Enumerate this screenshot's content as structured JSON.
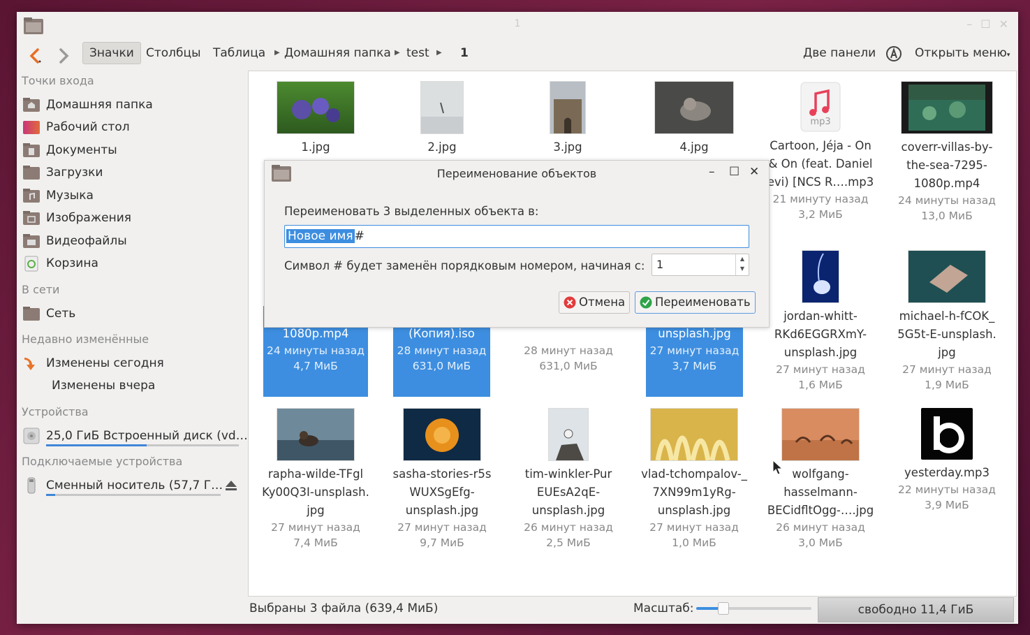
{
  "window": {
    "title": "1"
  },
  "toolbar": {
    "views": [
      "Значки",
      "Столбцы",
      "Таблица"
    ],
    "breadcrumb": [
      "Домашняя папка",
      "test",
      "1"
    ],
    "dual_pane": "Две панели",
    "open_menu": "Открыть меню"
  },
  "sidebar": {
    "headings": [
      "Точки входа",
      "В сети",
      "Недавно изменённые",
      "Устройства",
      "Подключаемые устройства"
    ],
    "places": [
      "Домашняя папка",
      "Рабочий стол",
      "Документы",
      "Загрузки",
      "Музыка",
      "Изображения",
      "Видеофайлы",
      "Корзина"
    ],
    "network": [
      "Сеть"
    ],
    "recent": [
      "Изменены сегодня",
      "Изменены вчера"
    ],
    "devices": [
      {
        "label": "25,0 ГиБ Встроенный диск (vd…",
        "usage": 0.52
      }
    ],
    "removable": [
      {
        "label": "Сменный носитель (57,7 Г…",
        "usage": 0.05
      }
    ]
  },
  "files": [
    {
      "name": "1.jpg"
    },
    {
      "name": "2.jpg"
    },
    {
      "name": "3.jpg"
    },
    {
      "name": "4.jpg"
    },
    {
      "name": "Cartoon, Jéja - On\n& On (feat. Daniel\nevi) [NCS R….mp3",
      "time": "21 минуту назад",
      "size": "3,2 МиБ"
    },
    {
      "name": "coverr-villas-by-\nthe-sea-7295-\n1080p.mp4",
      "time": "24 минуты назад",
      "size": "13,0 МиБ"
    },
    {
      "name": "1080p.mp4",
      "time": "24 минуты назад",
      "size": "4,7 МиБ"
    },
    {
      "name": "(Копия).iso",
      "time": "28 минут назад",
      "size": "631,0 МиБ"
    },
    {
      "name": "",
      "time": "28 минут назад",
      "size": "631,0 МиБ"
    },
    {
      "name": "unsplash.jpg",
      "time": "27 минут назад",
      "size": "3,7 МиБ"
    },
    {
      "name": "jordan-whitt-\nRKd6EGGRXmY-\nunsplash.jpg",
      "time": "27 минут назад",
      "size": "1,6 МиБ"
    },
    {
      "name": "michael-h-fCOK_\n5G5t-E-unsplash.\njpg",
      "time": "27 минут назад",
      "size": "1,9 МиБ"
    },
    {
      "name": "rapha-wilde-TFgl\nKy00Q3I-unsplash.\njpg",
      "time": "27 минут назад",
      "size": "7,4 МиБ"
    },
    {
      "name": "sasha-stories-r5s\nWUXSgEfg-\nunsplash.jpg",
      "time": "27 минут назад",
      "size": "9,7 МиБ"
    },
    {
      "name": "tim-winkler-Pur\nEUEsA2qE-\nunsplash.jpg",
      "time": "26 минут назад",
      "size": "2,5 МиБ"
    },
    {
      "name": "vlad-tchompalov-_\n7XN99m1yRg-\nunsplash.jpg",
      "time": "27 минут назад",
      "size": "1,0 МиБ"
    },
    {
      "name": "wolfgang-\nhasselmann-\nBECidfltOgg-….jpg",
      "time": "26 минут назад",
      "size": "3,0 МиБ"
    },
    {
      "name": "yesterday.mp3",
      "time": "22 минуты назад",
      "size": "3,9 МиБ"
    }
  ],
  "dialog": {
    "title": "Переименование объектов",
    "prompt": "Переименовать 3 выделенных объекта в:",
    "name_selected": "Новое имя",
    "name_rest": "#",
    "hint": "Символ # будет заменён порядковым номером, начиная с:",
    "start_value": "1",
    "cancel": "Отмена",
    "rename": "Переименовать"
  },
  "mp3_badge": "mp3",
  "status": {
    "selection": "Выбраны 3 файла (639,4 МиБ)",
    "zoom_label": "Масштаб:",
    "zoom_level": 0.23,
    "free": "свободно 11,4 ГиБ"
  },
  "colors": {
    "accent": "#3d8ee0",
    "folder": "#8c7b74"
  }
}
